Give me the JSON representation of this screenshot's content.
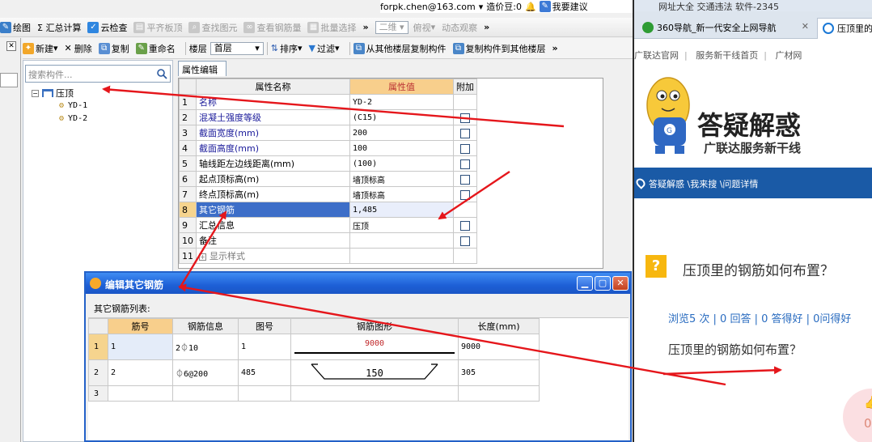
{
  "app": {
    "userbar": {
      "email": "forpk.chen@163.com",
      "cost_label": "造价豆:0",
      "suggest_label": "我要建议"
    },
    "toolbar1": {
      "items": [
        {
          "label": "绘图",
          "icon": "draw-icon",
          "enabled": true
        },
        {
          "label": "Σ 汇总计算",
          "icon": "sum-icon",
          "enabled": true
        },
        {
          "label": "云检查",
          "icon": "cloud-check-icon",
          "enabled": true
        },
        {
          "label": "平齐板顶",
          "icon": "align-top-icon",
          "enabled": false
        },
        {
          "label": "查找图元",
          "icon": "find-icon",
          "enabled": false
        },
        {
          "label": "查看钢筋量",
          "icon": "view-rebar-icon",
          "enabled": false
        },
        {
          "label": "批量选择",
          "icon": "batch-select-icon",
          "enabled": false
        }
      ],
      "view_2d": "二维",
      "view_top": "俯视",
      "view_dynamic": "动态观察"
    },
    "toolbar2": {
      "new": "新建",
      "delete": "删除",
      "copy": "复制",
      "rename": "重命名",
      "floor_label": "楼层",
      "floor_value": "首层",
      "sort": "排序",
      "filter": "过滤",
      "copy_from_floor": "从其他楼层复制构件",
      "copy_to_floor": "复制构件到其他楼层"
    },
    "tree": {
      "search_placeholder": "搜索构件...",
      "root": "压顶",
      "children": [
        "YD-1",
        "YD-2"
      ]
    },
    "property_editor": {
      "tab": "属性编辑",
      "headers": {
        "name": "属性名称",
        "value": "属性值",
        "extra": "附加"
      },
      "rows": [
        {
          "num": "1",
          "name": "名称",
          "value": "YD-2",
          "checkbox": false
        },
        {
          "num": "2",
          "name": "混凝土强度等级",
          "value": "(C15)",
          "checkbox": true
        },
        {
          "num": "3",
          "name": "截面宽度(mm)",
          "value": "200",
          "checkbox": true
        },
        {
          "num": "4",
          "name": "截面高度(mm)",
          "value": "100",
          "checkbox": true
        },
        {
          "num": "5",
          "name": "轴线距左边线距离(mm)",
          "value": "(100)",
          "checkbox": true
        },
        {
          "num": "6",
          "name": "起点顶标高(m)",
          "value": "墙顶标高",
          "checkbox": true
        },
        {
          "num": "7",
          "name": "终点顶标高(m)",
          "value": "墙顶标高",
          "checkbox": true
        },
        {
          "num": "8",
          "name": "其它钢筋",
          "value": "1,485",
          "checkbox": false
        },
        {
          "num": "9",
          "name": "汇总信息",
          "value": "压顶",
          "checkbox": true
        },
        {
          "num": "10",
          "name": "备注",
          "value": "",
          "checkbox": true
        },
        {
          "num": "11",
          "name": "显示样式",
          "value": "",
          "checkbox": false
        }
      ]
    },
    "dialog": {
      "title": "编辑其它钢筋",
      "list_label": "其它钢筋列表:",
      "headers": {
        "bar_no": "筋号",
        "bar_info": "钢筋信息",
        "fig_no": "图号",
        "shape": "钢筋图形",
        "length": "长度(mm)"
      },
      "rows": [
        {
          "rn": "1",
          "bar_no": "1",
          "bar_info": "2⏀10",
          "fig_no": "1",
          "shape_dim": "9000",
          "length": "9000"
        },
        {
          "rn": "2",
          "bar_no": "2",
          "bar_info": "⏀6@200",
          "fig_no": "485",
          "shape_dim": "150",
          "length": "305"
        },
        {
          "rn": "3",
          "bar_no": "",
          "bar_info": "",
          "fig_no": "",
          "shape_dim": "",
          "length": ""
        }
      ]
    }
  },
  "browser": {
    "top_items": "网址大全   交通违法   软件-2345",
    "tabs": [
      {
        "label": "360导航_新一代安全上网导航",
        "active": false
      },
      {
        "label": "压顶里的",
        "active": true
      }
    ],
    "nav": [
      "广联达官网",
      "服务新干线首页",
      "广材网"
    ],
    "logo": {
      "title": "答疑解惑",
      "subtitle": "广联达服务新干线"
    },
    "breadcrumb": "答疑解惑 \\我来搜 \\问题详情",
    "question": {
      "title": "压顶里的钢筋如何布置？",
      "stats": "浏览5 次 | 0 回答 | 0 答得好 | 0问得好",
      "body": "压顶里的钢筋如何布置？"
    },
    "like_count": "0"
  },
  "colors": {
    "accent_blue": "#1a5aa6",
    "header_orange": "#f8cf8c",
    "arrow_red": "#e5161b",
    "title_blue": "#2361c8"
  }
}
